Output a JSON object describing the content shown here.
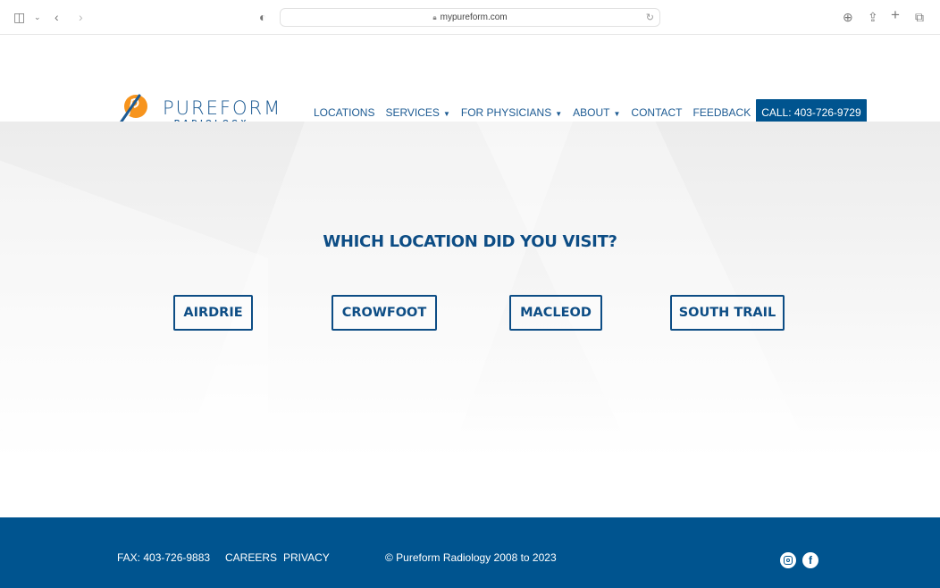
{
  "browser": {
    "url": "mypureform.com"
  },
  "brand": {
    "name": "PUREFORM",
    "sub": "RADIOLOGY",
    "accent": "#f7941d",
    "primary": "#00548f"
  },
  "nav": {
    "items": [
      {
        "label": "LOCATIONS",
        "caret": false
      },
      {
        "label": "SERVICES",
        "caret": true
      },
      {
        "label": "FOR PHYSICIANS",
        "caret": true
      },
      {
        "label": "ABOUT",
        "caret": true
      },
      {
        "label": "CONTACT",
        "caret": false
      },
      {
        "label": "FEEDBACK",
        "caret": false
      }
    ],
    "call": "CALL: 403-726-9729"
  },
  "main": {
    "title": "WHICH LOCATION DID YOU VISIT?",
    "locations": [
      "AIRDRIE",
      "CROWFOOT",
      "MACLEOD",
      "SOUTH TRAIL"
    ]
  },
  "footer": {
    "fax": "FAX: 403-726-9883",
    "careers": "CAREERS",
    "privacy": "PRIVACY",
    "copyright": "© Pureform Radiology 2008 to 2023",
    "social": [
      "instagram-icon",
      "facebook-icon"
    ]
  }
}
